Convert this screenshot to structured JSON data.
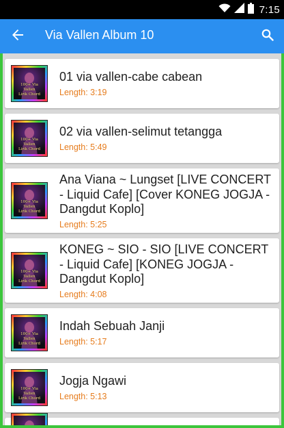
{
  "status_bar": {
    "time": "7:15",
    "icons": [
      "wifi-icon",
      "signal-icon",
      "battery-icon"
    ]
  },
  "app_bar": {
    "title": "Via Vallen Album 10",
    "back_icon": "arrow-left-icon",
    "search_icon": "search-icon",
    "background_color": "#2b8ff0"
  },
  "list": {
    "frame_color": "#3cc63c",
    "length_color": "#e67c1d",
    "thumbnail_caption": [
      "100+ Via Vallen",
      "Lirik Chord"
    ],
    "items": [
      {
        "title": "01 via vallen-cabe cabean",
        "length": "Length: 3:19"
      },
      {
        "title": "02 via vallen-selimut tetangga",
        "length": "Length: 5:49"
      },
      {
        "title": "Ana Viana ~ Lungset [LIVE CONCERT - Liquid Cafe] [Cover KONEG JOGJA - Dangdut Koplo]",
        "length": "Length: 5:25"
      },
      {
        "title": "KONEG ~ SIO - SIO [LIVE CONCERT - Liquid Cafe] [KONEG JOGJA - Dangdut Koplo]",
        "length": "Length: 4:08"
      },
      {
        "title": "Indah Sebuah Janji",
        "length": "Length: 5:17"
      },
      {
        "title": "Jogja Ngawi",
        "length": "Length: 5:13"
      }
    ]
  }
}
